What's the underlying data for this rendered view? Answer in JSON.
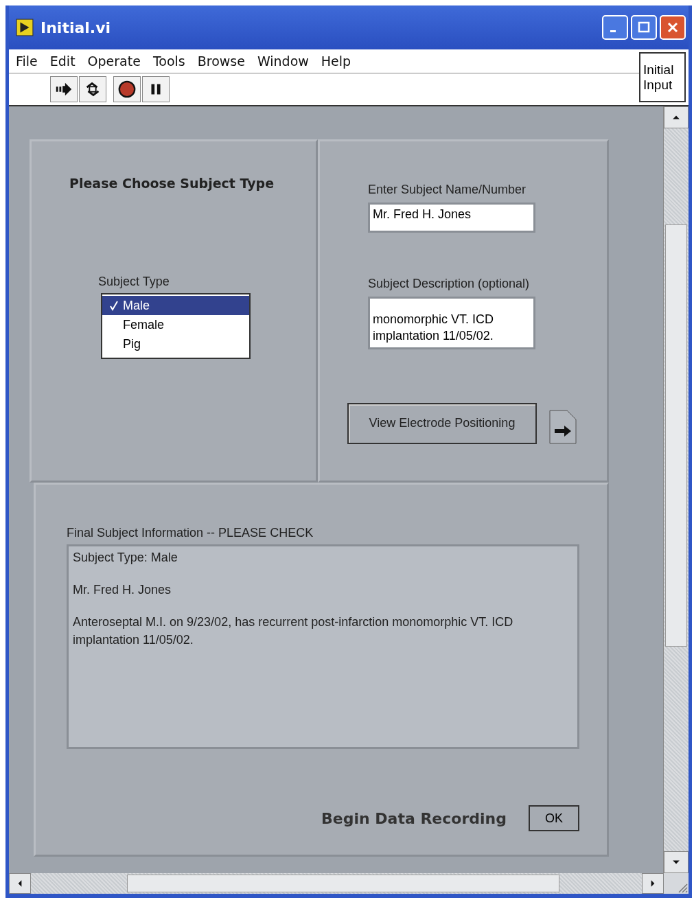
{
  "window": {
    "title": "Initial.vi"
  },
  "menu": [
    "File",
    "Edit",
    "Operate",
    "Tools",
    "Browse",
    "Window",
    "Help"
  ],
  "toolbar": [
    {
      "kind": "run"
    },
    {
      "kind": "run-continuous"
    },
    {
      "kind": "abort"
    },
    {
      "kind": "pause"
    }
  ],
  "vi_label": [
    "Initial",
    "Input"
  ],
  "subject_type_panel": {
    "heading": "Please Choose Subject Type",
    "label": "Subject Type",
    "options": [
      {
        "label": "Male",
        "selected": true
      },
      {
        "label": "Female",
        "selected": false
      },
      {
        "label": "Pig",
        "selected": false
      }
    ]
  },
  "subject_panel": {
    "name_label": "Enter Subject Name/Number",
    "name_value": "Mr. Fred H. Jones",
    "description_label": "Subject Description (optional)",
    "description_lines": [
      "monomorphic VT. ICD",
      "implantation 11/05/02."
    ],
    "button": "View Electrode Positioning"
  },
  "final_panel": {
    "label": "Final Subject Information -- PLEASE CHECK",
    "paragraphs": [
      "Subject Type: Male",
      "Mr. Fred H. Jones",
      "Anteroseptal M.I. on 9/23/02, has recurrent post-infarction monomorphic VT. ICD implantation 11/05/02."
    ],
    "action_label": "Begin Data Recording",
    "ok_button": "OK"
  }
}
